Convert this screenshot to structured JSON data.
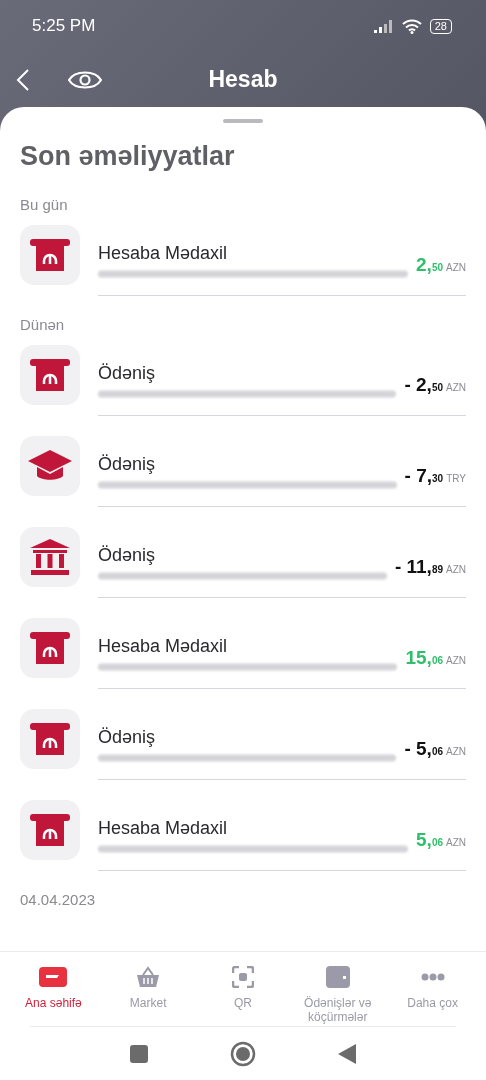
{
  "status_bar": {
    "time": "5:25 PM",
    "battery": "28"
  },
  "header": {
    "title": "Hesab"
  },
  "sheet": {
    "title": "Son əməliyyatlar",
    "groups": [
      {
        "label": "Bu gün",
        "transactions": [
          {
            "kind": "atm",
            "title": "Hesaba Mədaxil",
            "whole": "2,",
            "cents": "50",
            "currency": "AZN",
            "credit": true
          }
        ]
      },
      {
        "label": "Dünən",
        "transactions": [
          {
            "kind": "atm",
            "title": "Ödəniş",
            "whole": "- 2,",
            "cents": "50",
            "currency": "AZN",
            "credit": false
          },
          {
            "kind": "education",
            "title": "Ödəniş",
            "whole": "- 7,",
            "cents": "30",
            "currency": "TRY",
            "credit": false
          },
          {
            "kind": "bank",
            "title": "Ödəniş",
            "whole": "- 11,",
            "cents": "89",
            "currency": "AZN",
            "credit": false
          },
          {
            "kind": "atm",
            "title": "Hesaba Mədaxil",
            "whole": "15,",
            "cents": "06",
            "currency": "AZN",
            "credit": true
          },
          {
            "kind": "atm",
            "title": "Ödəniş",
            "whole": "- 5,",
            "cents": "06",
            "currency": "AZN",
            "credit": false
          },
          {
            "kind": "atm",
            "title": "Hesaba Mədaxil",
            "whole": "5,",
            "cents": "06",
            "currency": "AZN",
            "credit": true
          }
        ]
      },
      {
        "label": "04.04.2023"
      }
    ]
  },
  "bottom_nav": [
    {
      "kind": "card",
      "label": "Ana səhifə",
      "selected": true
    },
    {
      "kind": "basket",
      "label": "Market",
      "selected": false
    },
    {
      "kind": "qr",
      "label": "QR",
      "selected": false
    },
    {
      "kind": "wallet",
      "label": "Ödənişlər və köçürmələr",
      "selected": false
    },
    {
      "kind": "more",
      "label": "Daha çox",
      "selected": false
    }
  ]
}
